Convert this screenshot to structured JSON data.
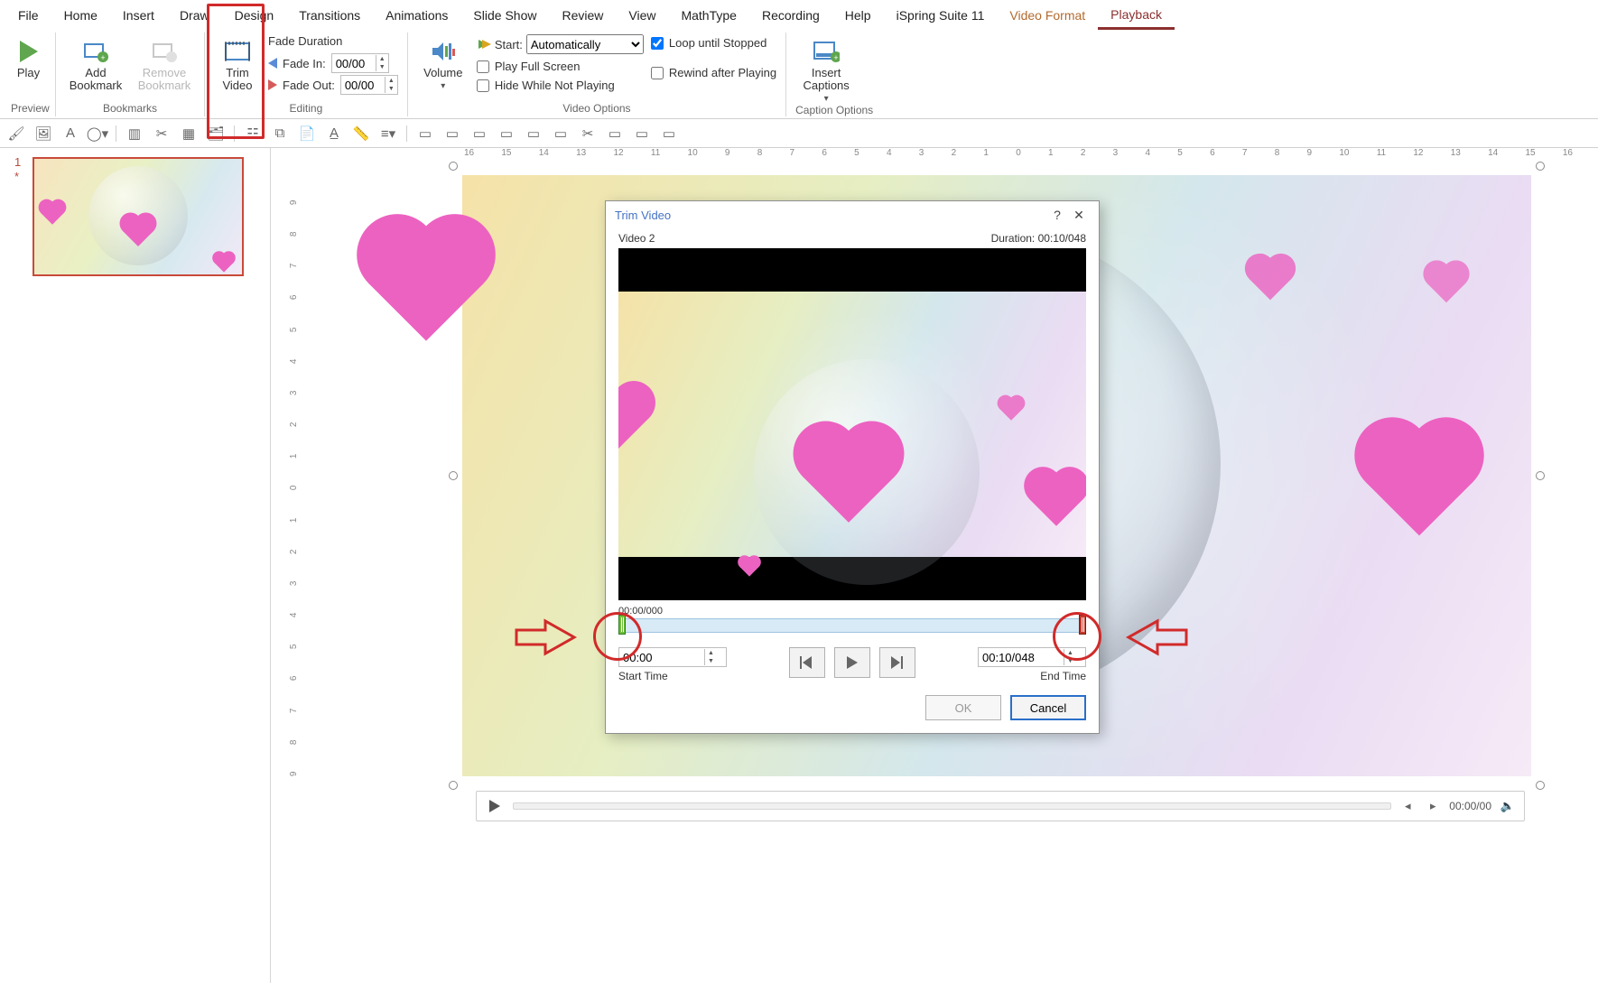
{
  "tabs": {
    "file": "File",
    "home": "Home",
    "insert": "Insert",
    "draw": "Draw",
    "design": "Design",
    "transitions": "Transitions",
    "animations": "Animations",
    "slideshow": "Slide Show",
    "review": "Review",
    "view": "View",
    "mathtype": "MathType",
    "recording": "Recording",
    "help": "Help",
    "ispring": "iSpring Suite 11",
    "videoformat": "Video Format",
    "playback": "Playback"
  },
  "ribbon": {
    "preview": {
      "play": "Play",
      "group": "Preview"
    },
    "bookmarks": {
      "add": "Add\nBookmark",
      "remove": "Remove\nBookmark",
      "group": "Bookmarks"
    },
    "editing": {
      "trim": "Trim\nVideo",
      "fadeTitle": "Fade Duration",
      "fadeIn": "Fade In:",
      "fadeOut": "Fade Out:",
      "fadeInVal": "00/00",
      "fadeOutVal": "00/00",
      "group": "Editing"
    },
    "video": {
      "volume": "Volume",
      "start": "Start:",
      "startVal": "Automatically",
      "fullscreen": "Play Full Screen",
      "hide": "Hide While Not Playing",
      "loop": "Loop until Stopped",
      "rewind": "Rewind after Playing",
      "group": "Video Options"
    },
    "captions": {
      "insert": "Insert\nCaptions",
      "group": "Caption Options"
    }
  },
  "thumb": {
    "num": "1",
    "star": "*"
  },
  "hruler": [
    "16",
    "15",
    "14",
    "13",
    "12",
    "11",
    "10",
    "9",
    "8",
    "7",
    "6",
    "5",
    "4",
    "3",
    "2",
    "1",
    "0",
    "1",
    "2",
    "3",
    "4",
    "5",
    "6",
    "7",
    "8",
    "9",
    "10",
    "11",
    "12",
    "13",
    "14",
    "15",
    "16"
  ],
  "vruler": [
    "9",
    "8",
    "7",
    "6",
    "5",
    "4",
    "3",
    "2",
    "1",
    "0",
    "1",
    "2",
    "3",
    "4",
    "5",
    "6",
    "7",
    "8",
    "9"
  ],
  "vidbar": {
    "time": "00:00/00"
  },
  "dialog": {
    "title": "Trim Video",
    "name": "Video 2",
    "duration": "Duration: 00:10/048",
    "timecode": "00:00/000",
    "start": "00:00",
    "end": "00:10/048",
    "startLbl": "Start Time",
    "endLbl": "End Time",
    "ok": "OK",
    "cancel": "Cancel",
    "help": "?",
    "close": "✕"
  }
}
